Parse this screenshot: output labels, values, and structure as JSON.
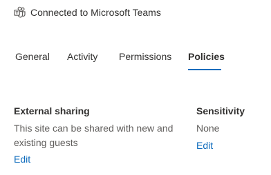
{
  "teams": {
    "icon": "microsoft-teams-icon",
    "label": "Connected to Microsoft Teams"
  },
  "tabs": [
    {
      "label": "General",
      "active": false
    },
    {
      "label": "Activity",
      "active": false
    },
    {
      "label": "Permissions",
      "active": false
    },
    {
      "label": "Policies",
      "active": true
    }
  ],
  "external_sharing": {
    "title": "External sharing",
    "description": "This site can be shared with new and existing guests",
    "edit_label": "Edit"
  },
  "sensitivity": {
    "title": "Sensitivity",
    "value": "None",
    "edit_label": "Edit"
  },
  "colors": {
    "accent": "#0f6cbd",
    "text_primary": "#323130",
    "text_secondary": "#605e5c"
  }
}
